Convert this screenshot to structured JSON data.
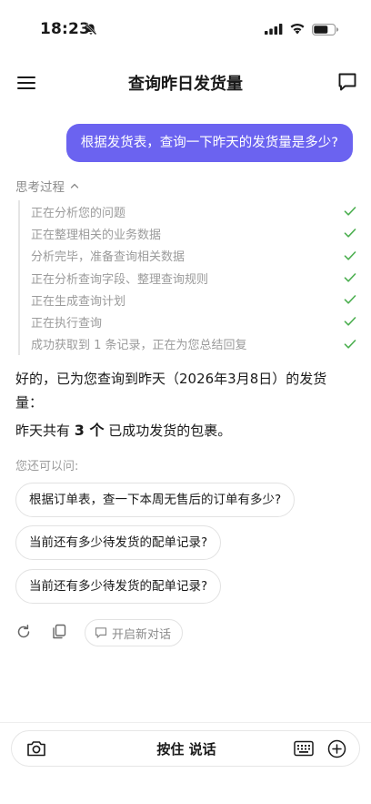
{
  "status_bar": {
    "time": "18:23"
  },
  "header": {
    "title": "查询昨日发货量"
  },
  "user_message": "根据发货表，查询一下昨天的发货量是多少?",
  "thinking": {
    "label": "思考过程",
    "steps": [
      "正在分析您的问题",
      "正在整理相关的业务数据",
      "分析完毕，准备查询相关数据",
      "正在分析查询字段、整理查询规则",
      "正在生成查询计划",
      "正在执行查询",
      "成功获取到 1 条记录，正在为您总结回复"
    ]
  },
  "answer": {
    "line1": "好的，已为您查询到昨天（2026年3月8日）的发货量：",
    "summary_prefix": "昨天共有",
    "summary_count": "3 个",
    "summary_suffix": "已成功发货的包裹。"
  },
  "suggestions": {
    "label": "您还可以问:",
    "items": [
      "根据订单表，查一下本周无售后的订单有多少?",
      "当前还有多少待发货的配单记录?",
      "当前还有多少待发货的配单记录?"
    ]
  },
  "actions": {
    "new_chat_label": "开启新对话"
  },
  "input_bar": {
    "hold_to_talk": "按住 说话"
  },
  "colors": {
    "accent": "#6b63f0",
    "check": "#4caf50"
  }
}
